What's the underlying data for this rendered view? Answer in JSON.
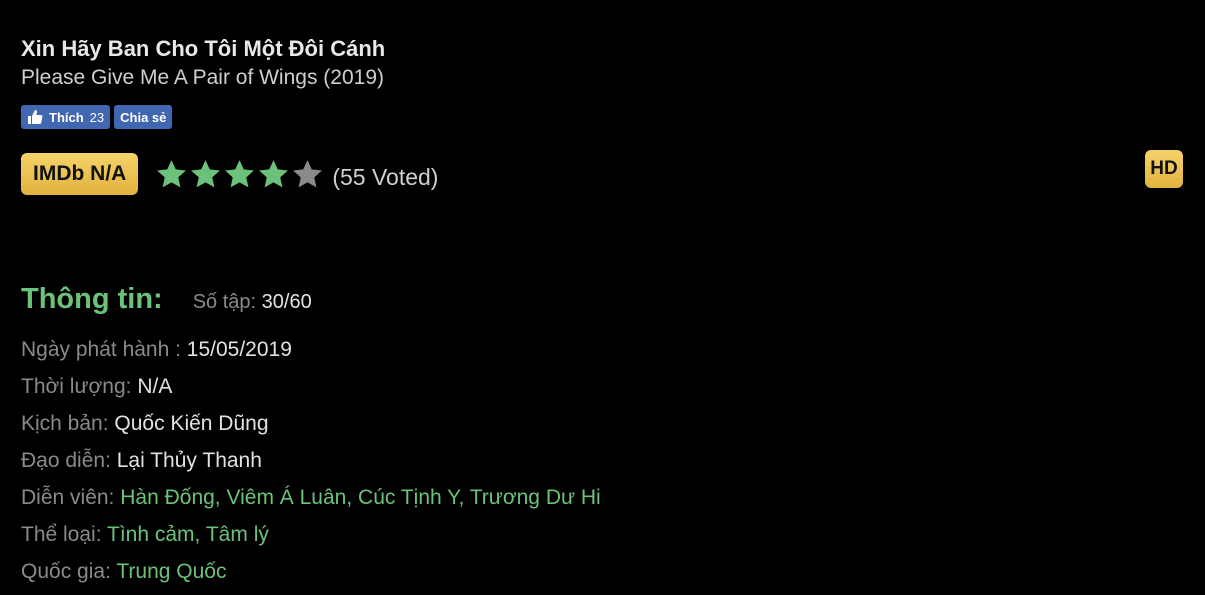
{
  "movie": {
    "title": "Xin Hãy Ban Cho Tôi Một Đôi Cánh",
    "subtitle": "Please Give Me A Pair of Wings (2019)"
  },
  "social": {
    "like_label": "Thích",
    "like_count": "23",
    "share_label": "Chia sẻ",
    "like_icon": "thumbs-up-icon"
  },
  "rating": {
    "imdb_label": "IMDb N/A",
    "stars_filled": 4,
    "stars_total": 5,
    "voted_text": "(55 Voted)",
    "star_color": "#6cc27a",
    "star_empty_color": "#8a8a8a"
  },
  "quality_badge": "HD",
  "info": {
    "heading": "Thông tin:",
    "episodes_label": "Số tập:",
    "episodes_value": "30/60",
    "release_label": "Ngày phát hành :",
    "release_value": "15/05/2019",
    "duration_label": "Thời lượng:",
    "duration_value": "N/A",
    "script_label": "Kịch bản:",
    "script_value": "Quốc Kiến Dũng",
    "director_label": "Đạo diễn:",
    "director_value": "Lại Thủy Thanh",
    "cast_label": "Diễn viên:",
    "cast": [
      "Hàn Đống",
      "Viêm Á Luân",
      "Cúc Tịnh Y",
      "Trương Dư Hi"
    ],
    "genre_label": "Thể loại:",
    "genres": [
      "Tình cảm",
      "Tâm lý"
    ],
    "country_label": "Quốc gia:",
    "country_value": "Trung Quốc"
  },
  "colors": {
    "background": "#000000",
    "accent_green": "#6cc27a",
    "gold": "#e8c04f",
    "facebook_blue": "#4267b2"
  }
}
